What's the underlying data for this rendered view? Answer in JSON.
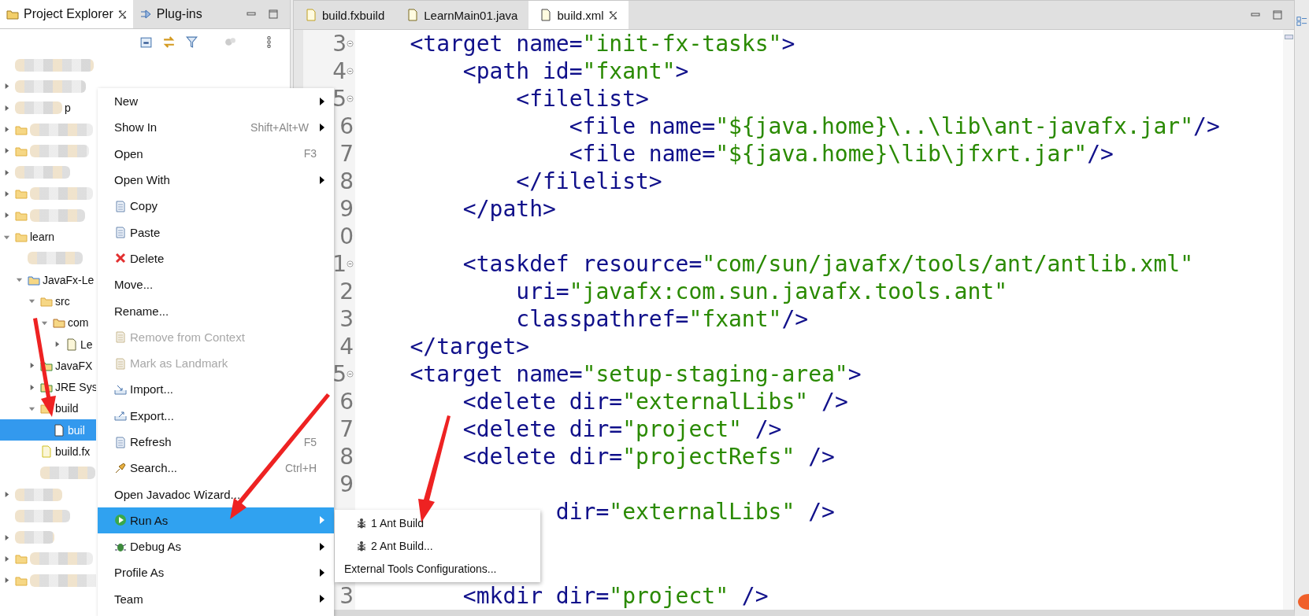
{
  "explorer": {
    "tabs": [
      {
        "label": "Project Explorer",
        "selected": true
      },
      {
        "label": "Plug-ins",
        "selected": false
      }
    ],
    "tree": [
      {
        "kind": "none",
        "selected": false
      },
      {
        "kind": "none",
        "expanded": false,
        "selected": false
      },
      {
        "kind": "none",
        "fragment": "p",
        "expanded": false,
        "selected": false
      },
      {
        "kind": "project",
        "expanded": false,
        "selected": false
      },
      {
        "kind": "project",
        "expanded": false,
        "selected": false
      },
      {
        "kind": "none",
        "expanded": false,
        "selected": false
      },
      {
        "kind": "project",
        "expanded": false,
        "selected": false
      },
      {
        "kind": "project",
        "expanded": false,
        "selected": false
      },
      {
        "kind": "project",
        "label": "learn",
        "expanded": true,
        "selected": false,
        "children": [
          {
            "kind": "none",
            "selected": false
          },
          {
            "kind": "java-project",
            "label": "JavaFx-Le",
            "expanded": true,
            "selected": false,
            "children": [
              {
                "kind": "source-folder",
                "label": "src",
                "expanded": true,
                "selected": false,
                "children": [
                  {
                    "kind": "package",
                    "label": "com",
                    "expanded": true,
                    "selected": false,
                    "children": [
                      {
                        "kind": "java-file",
                        "label": "Le",
                        "expanded": false,
                        "selected": false
                      }
                    ]
                  }
                ]
              },
              {
                "kind": "library",
                "label": "JavaFX",
                "expanded": false,
                "selected": false
              },
              {
                "kind": "library",
                "label": "JRE Sys",
                "expanded": false,
                "selected": false
              },
              {
                "kind": "folder",
                "label": "build",
                "expanded": true,
                "selected": false,
                "children": [
                  {
                    "kind": "ant-file",
                    "label": "buil",
                    "selected": true
                  }
                ]
              },
              {
                "kind": "fxbuild-file",
                "label": "build.fx",
                "selected": false
              },
              {
                "kind": "none",
                "selected": false
              }
            ]
          }
        ]
      },
      {
        "kind": "none",
        "expanded": false,
        "selected": false
      },
      {
        "kind": "none",
        "selected": false
      },
      {
        "kind": "none",
        "expanded": false,
        "selected": false
      },
      {
        "kind": "project",
        "expanded": false,
        "selected": false
      },
      {
        "kind": "project",
        "expanded": false,
        "selected": false
      }
    ]
  },
  "editor": {
    "tabs": [
      {
        "label": "build.fxbuild",
        "kind": "fxbuild",
        "selected": false
      },
      {
        "label": "LearnMain01.java",
        "kind": "java",
        "selected": false
      },
      {
        "label": "build.xml",
        "kind": "ant",
        "selected": true
      }
    ],
    "lines": [
      {
        "number": "3",
        "fold": true,
        "tokens": [
          {
            "kind": "tag",
            "text": "    <target name="
          },
          {
            "kind": "value",
            "text": "\"init-fx-tasks\""
          },
          {
            "kind": "tag",
            "text": ">"
          }
        ]
      },
      {
        "number": "4",
        "fold": true,
        "tokens": [
          {
            "kind": "tag",
            "text": "        <path id="
          },
          {
            "kind": "value",
            "text": "\"fxant\""
          },
          {
            "kind": "tag",
            "text": ">"
          }
        ]
      },
      {
        "number": "5",
        "fold": true,
        "tokens": [
          {
            "kind": "tag",
            "text": "            <filelist>"
          }
        ]
      },
      {
        "number": "6",
        "tokens": [
          {
            "kind": "tag",
            "text": "                <file name="
          },
          {
            "kind": "value",
            "text": "\"${java.home}\\..\\lib\\ant-javafx.jar\""
          },
          {
            "kind": "tag",
            "text": "/>"
          }
        ]
      },
      {
        "number": "7",
        "tokens": [
          {
            "kind": "tag",
            "text": "                <file name="
          },
          {
            "kind": "value",
            "text": "\"${java.home}\\lib\\jfxrt.jar\""
          },
          {
            "kind": "tag",
            "text": "/>"
          }
        ]
      },
      {
        "number": "8",
        "tokens": [
          {
            "kind": "tag",
            "text": "            </filelist>"
          }
        ]
      },
      {
        "number": "9",
        "tokens": [
          {
            "kind": "tag",
            "text": "        </path>"
          }
        ]
      },
      {
        "number": "0"
      },
      {
        "number": "1",
        "fold": true,
        "tokens": [
          {
            "kind": "tag",
            "text": "        <taskdef resource="
          },
          {
            "kind": "value",
            "text": "\"com/sun/javafx/tools/ant/antlib.xml\""
          }
        ]
      },
      {
        "number": "2",
        "tokens": [
          {
            "kind": "tag",
            "text": "            uri="
          },
          {
            "kind": "value",
            "text": "\"javafx:com.sun.javafx.tools.ant\""
          }
        ]
      },
      {
        "number": "3",
        "tokens": [
          {
            "kind": "tag",
            "text": "            classpathref="
          },
          {
            "kind": "value",
            "text": "\"fxant\""
          },
          {
            "kind": "tag",
            "text": "/>"
          }
        ]
      },
      {
        "number": "4",
        "tokens": [
          {
            "kind": "tag",
            "text": "    </target>"
          }
        ]
      },
      {
        "number": "5",
        "fold": true,
        "tokens": [
          {
            "kind": "tag",
            "text": "    <target name="
          },
          {
            "kind": "value",
            "text": "\"setup-staging-area\""
          },
          {
            "kind": "tag",
            "text": ">"
          }
        ]
      },
      {
        "number": "6",
        "tokens": [
          {
            "kind": "tag",
            "text": "        <delete dir="
          },
          {
            "kind": "value",
            "text": "\"externalLibs\""
          },
          {
            "kind": "tag",
            "text": " />"
          }
        ]
      },
      {
        "number": "7",
        "tokens": [
          {
            "kind": "tag",
            "text": "        <delete dir="
          },
          {
            "kind": "value",
            "text": "\"project\""
          },
          {
            "kind": "tag",
            "text": " />"
          }
        ]
      },
      {
        "number": "8",
        "tokens": [
          {
            "kind": "tag",
            "text": "        <delete dir="
          },
          {
            "kind": "value",
            "text": "\"projectRefs\""
          },
          {
            "kind": "tag",
            "text": " />"
          }
        ]
      },
      {
        "number": "9"
      },
      {
        "tokens": [
          {
            "kind": "tag",
            "text": "               dir="
          },
          {
            "kind": "value",
            "text": "\"externalLibs\""
          },
          {
            "kind": "tag",
            "text": " />"
          }
        ]
      },
      {
        "number": "3",
        "tokens": [
          {
            "kind": "tag",
            "text": "        <mkdir dir="
          },
          {
            "kind": "value",
            "text": "\"project\""
          },
          {
            "kind": "tag",
            "text": " />"
          }
        ]
      }
    ]
  },
  "context_menu": {
    "items": [
      {
        "label": "New",
        "submenu": true,
        "disabled": false,
        "selected": false
      },
      {
        "label": "Show In",
        "shortcut": "Shift+Alt+W",
        "submenu": true,
        "disabled": false,
        "selected": false
      },
      {
        "label": "Open",
        "shortcut": "F3",
        "submenu": false,
        "disabled": false,
        "selected": false
      },
      {
        "label": "Open With",
        "submenu": true,
        "disabled": false,
        "selected": false
      },
      {
        "label": "Copy",
        "submenu": false,
        "disabled": false,
        "selected": false
      },
      {
        "label": "Paste",
        "submenu": false,
        "disabled": false,
        "selected": false
      },
      {
        "label": "Delete",
        "submenu": false,
        "disabled": false,
        "selected": false
      },
      {
        "label": "Move...",
        "submenu": false,
        "disabled": false,
        "selected": false
      },
      {
        "label": "Rename...",
        "submenu": false,
        "disabled": false,
        "selected": false
      },
      {
        "label": "Remove from Context",
        "submenu": false,
        "disabled": true,
        "selected": false
      },
      {
        "label": "Mark as Landmark",
        "submenu": false,
        "disabled": true,
        "selected": false
      },
      {
        "label": "Import...",
        "submenu": false,
        "disabled": false,
        "selected": false
      },
      {
        "label": "Export...",
        "submenu": false,
        "disabled": false,
        "selected": false
      },
      {
        "label": "Refresh",
        "shortcut": "F5",
        "submenu": false,
        "disabled": false,
        "selected": false
      },
      {
        "label": "Search...",
        "shortcut": "Ctrl+H",
        "submenu": false,
        "disabled": false,
        "selected": false
      },
      {
        "label": "Open Javadoc Wizard...",
        "submenu": false,
        "disabled": false,
        "selected": false
      },
      {
        "label": "Run As",
        "submenu": true,
        "disabled": false,
        "selected": true
      },
      {
        "label": "Debug As",
        "submenu": true,
        "disabled": false,
        "selected": false
      },
      {
        "label": "Profile As",
        "submenu": true,
        "disabled": false,
        "selected": false
      },
      {
        "label": "Team",
        "submenu": true,
        "disabled": false,
        "selected": false
      }
    ]
  },
  "submenu": {
    "items": [
      {
        "label": "1 Ant Build",
        "kind": "ant"
      },
      {
        "label": "2 Ant Build...",
        "kind": "ant"
      },
      {
        "label": "External Tools Configurations...",
        "kind": "plain"
      }
    ]
  }
}
